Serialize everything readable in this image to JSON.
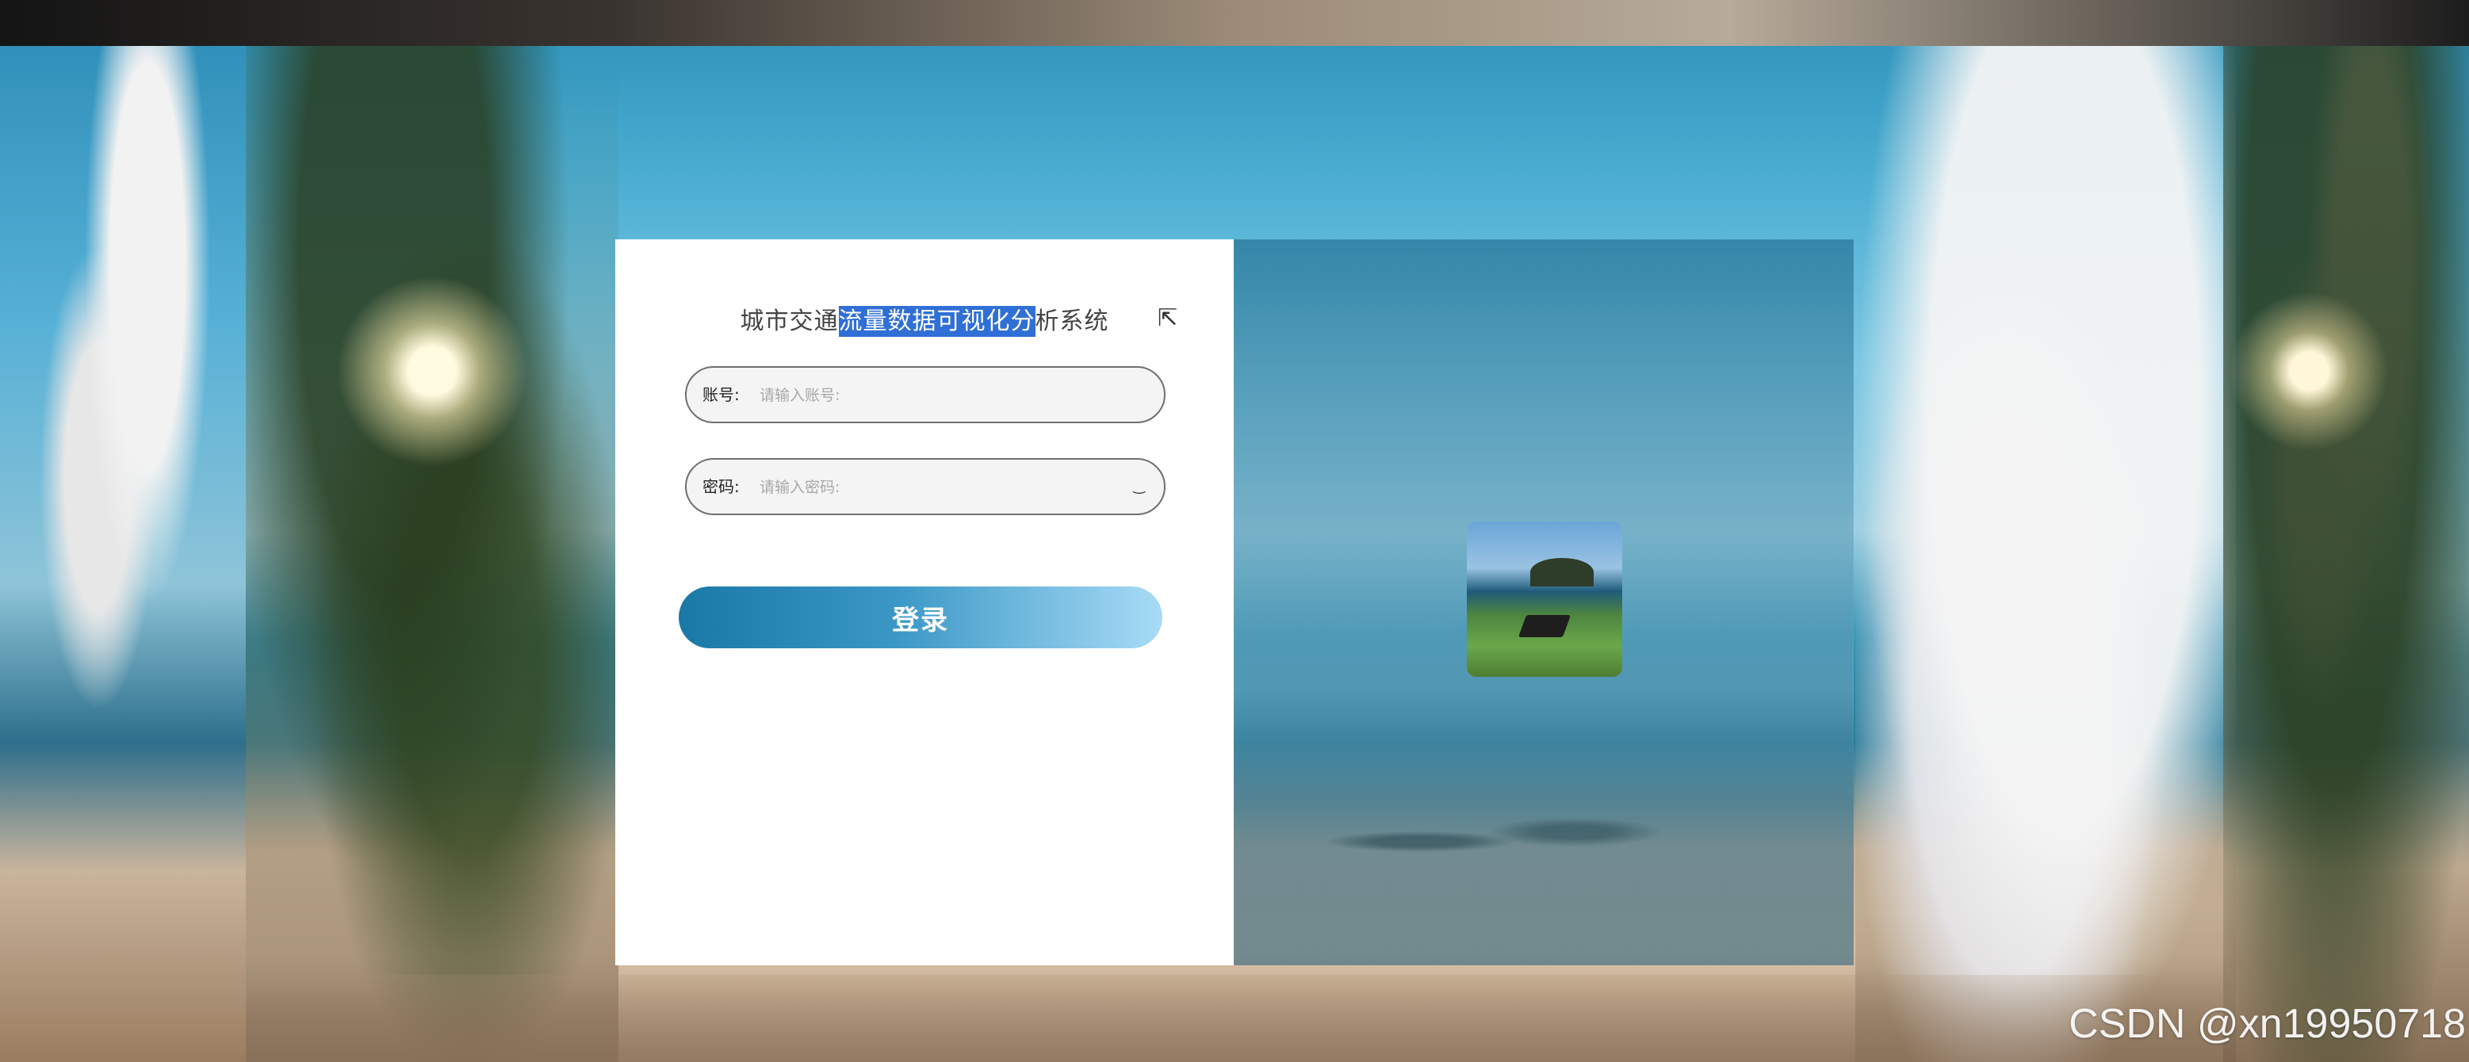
{
  "login": {
    "title_before": "城市交通",
    "title_selected": "流量数据可视化分",
    "title_after": "析系统",
    "account_label": "账号:",
    "account_placeholder": "请输入账号:",
    "password_label": "密码:",
    "password_placeholder": "请输入密码:",
    "login_button": "登录"
  },
  "icons": {
    "eye": "closed-eye-icon",
    "cursor": "mouse-pointer-icon"
  },
  "watermark": "CSDN @xn19950718",
  "colors": {
    "selection": "#2f6fd6",
    "button_start": "#1a78a6",
    "button_end": "#a8dbf6"
  }
}
